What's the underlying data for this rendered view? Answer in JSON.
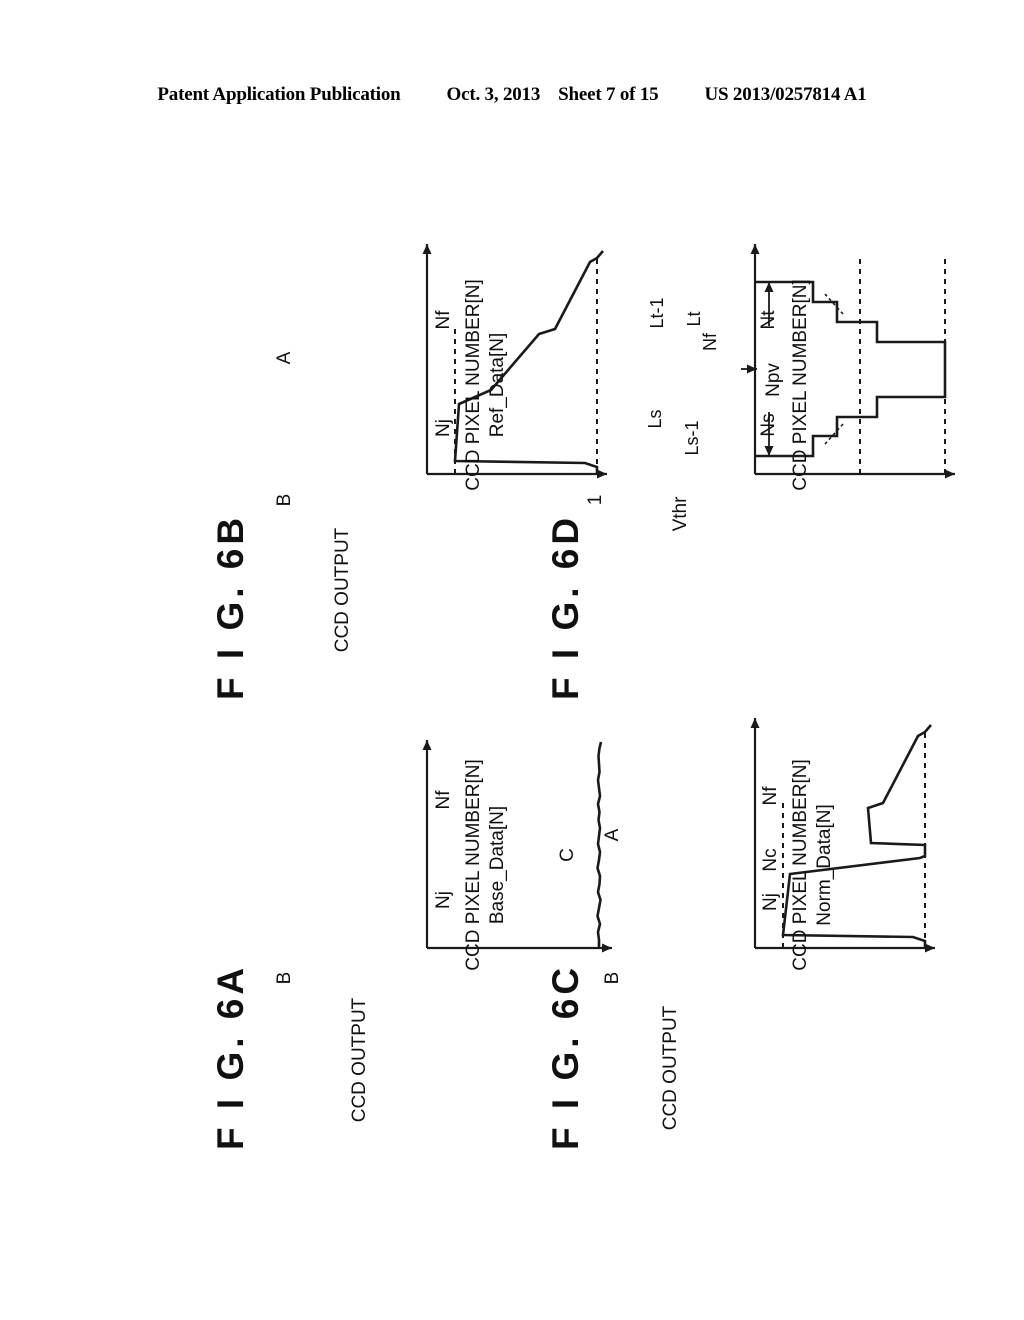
{
  "header": {
    "publication": "Patent Application Publication",
    "date": "Oct. 3, 2013",
    "sheet": "Sheet 7 of 15",
    "patent_number": "US 2013/0257814 A1"
  },
  "figures": [
    {
      "id": "fig-6a",
      "title": "F I G.  6A",
      "y_axis_label": "CCD OUTPUT",
      "x_axis_label_line1": "CCD PIXEL NUMBER[N]",
      "x_axis_label_line2": "Base_Data[N]",
      "y_ticks": [
        "B"
      ],
      "x_ticks": [
        "Nj",
        "Nf"
      ]
    },
    {
      "id": "fig-6b",
      "title": "F I G.  6B",
      "y_axis_label": "CCD OUTPUT",
      "x_axis_label_line1": "CCD PIXEL NUMBER[N]",
      "x_axis_label_line2": "Ref_Data[N]",
      "y_ticks": [
        "B",
        "A"
      ],
      "x_ticks": [
        "Nj",
        "Nf"
      ]
    },
    {
      "id": "fig-6c",
      "title": "F I G.  6C",
      "y_axis_label": "CCD OUTPUT",
      "x_axis_label_line1": "CCD PIXEL NUMBER[N]",
      "x_axis_label_line2": "Norm_Data[N]",
      "y_ticks": [
        "B",
        "A"
      ],
      "x_ticks": [
        "Nj",
        "Nc",
        "Nf"
      ],
      "annotations": [
        "C"
      ]
    },
    {
      "id": "fig-6d",
      "title": "F I G.  6D",
      "y_axis_label": "",
      "x_axis_label_line1": "CCD PIXEL NUMBER[N]",
      "x_axis_label_line2": "",
      "y_ticks": [
        "1",
        "Vthr"
      ],
      "x_ticks": [
        "Ns",
        "Npv",
        "Nt"
      ],
      "annotations": [
        "Ls",
        "Ls-1",
        "Lt-1",
        "Lt",
        "Nf"
      ]
    }
  ],
  "chart_data": [
    {
      "type": "line",
      "figure": "6A",
      "title": "F I G.  6A",
      "xlabel": "CCD PIXEL NUMBER[N] Base_Data[N]",
      "ylabel": "CCD OUTPUT",
      "xticks": [
        "Nj",
        "Nf"
      ],
      "yticks": [
        "B"
      ],
      "series": [
        {
          "name": "Base_Data[N]",
          "description": "Nearly flat noisy signal held at level B across all pixel numbers",
          "points": [
            {
              "x": 0,
              "y": 1.0
            },
            {
              "x": 0.08,
              "y": 1.0
            },
            {
              "x": 0.16,
              "y": 0.995
            },
            {
              "x": 0.24,
              "y": 1.005
            },
            {
              "x": 0.33,
              "y": 0.99
            },
            {
              "x": 0.42,
              "y": 1.0
            },
            {
              "x": 0.5,
              "y": 1.008
            },
            {
              "x": 0.58,
              "y": 0.995
            },
            {
              "x": 0.66,
              "y": 1.0
            },
            {
              "x": 0.75,
              "y": 1.005
            },
            {
              "x": 0.83,
              "y": 0.992
            },
            {
              "x": 0.92,
              "y": 1.0
            },
            {
              "x": 1.0,
              "y": 1.0
            }
          ]
        }
      ]
    },
    {
      "type": "line",
      "figure": "6B",
      "title": "F I G.  6B",
      "xlabel": "CCD PIXEL NUMBER[N] Ref_Data[N]",
      "ylabel": "CCD OUTPUT",
      "xticks": [
        "Nj",
        "Nf"
      ],
      "yticks": [
        "B",
        "A"
      ],
      "series": [
        {
          "name": "Ref_Data[N]",
          "description": "Starts at B, drops to A near Nj, slowly rises, steps up and returns to B after Nf",
          "points": [
            {
              "x": 0.0,
              "y": 1.0
            },
            {
              "x": 0.03,
              "y": 1.0
            },
            {
              "x": 0.05,
              "y": 0.93
            },
            {
              "x": 0.06,
              "y": 0.0
            },
            {
              "x": 0.3,
              "y": 0.06
            },
            {
              "x": 0.36,
              "y": 0.3
            },
            {
              "x": 0.6,
              "y": 0.62
            },
            {
              "x": 0.62,
              "y": 0.7
            },
            {
              "x": 0.96,
              "y": 0.95
            },
            {
              "x": 0.97,
              "y": 1.0
            },
            {
              "x": 1.0,
              "y": 1.0
            }
          ]
        }
      ]
    },
    {
      "type": "line",
      "figure": "6C",
      "title": "F I G.  6C",
      "xlabel": "CCD PIXEL NUMBER[N] Norm_Data[N]",
      "ylabel": "CCD OUTPUT",
      "xticks": [
        "Nj",
        "Nc",
        "Nf"
      ],
      "yticks": [
        "B",
        "A"
      ],
      "annotation": "C",
      "series": [
        {
          "name": "Norm_Data[N]",
          "description": "Like Ref_Data but with a narrow full-height spike to B at pixel Nc",
          "points": [
            {
              "x": 0.0,
              "y": 1.0
            },
            {
              "x": 0.03,
              "y": 1.0
            },
            {
              "x": 0.05,
              "y": 0.93
            },
            {
              "x": 0.06,
              "y": 0.0
            },
            {
              "x": 0.32,
              "y": 0.08
            },
            {
              "x": 0.4,
              "y": 0.78
            },
            {
              "x": 0.42,
              "y": 1.0
            },
            {
              "x": 0.46,
              "y": 1.0
            },
            {
              "x": 0.47,
              "y": 0.66
            },
            {
              "x": 0.6,
              "y": 0.63
            },
            {
              "x": 0.62,
              "y": 0.72
            },
            {
              "x": 0.96,
              "y": 0.95
            },
            {
              "x": 0.97,
              "y": 1.0
            },
            {
              "x": 1.0,
              "y": 1.0
            }
          ]
        }
      ]
    },
    {
      "type": "line",
      "figure": "6D",
      "title": "F I G.  6D",
      "xlabel": "CCD PIXEL NUMBER[N]",
      "ylabel": "",
      "xticks": [
        "Ns",
        "Npv",
        "Nt"
      ],
      "yticks": [
        "1",
        "Vthr"
      ],
      "annotations": [
        "Ls",
        "Ls-1",
        "Lt-1",
        "Lt",
        "Nf"
      ],
      "series": [
        {
          "name": "staircase",
          "description": "Symmetric staircase rising from below Vthr at Ns through Ls-1, Ls to level 1 at the peak Npv, then descending through Lt, Lt-1 to Nt",
          "steps": [
            {
              "x": 0.0,
              "level": 0.12
            },
            {
              "x": 0.07,
              "level": 0.34
            },
            {
              "x": 0.16,
              "level": 0.46
            },
            {
              "x": 0.26,
              "level": 0.72
            },
            {
              "x": 0.4,
              "level": 1.0
            },
            {
              "x": 0.6,
              "level": 0.72
            },
            {
              "x": 0.74,
              "level": 0.46
            },
            {
              "x": 0.84,
              "level": 0.34
            },
            {
              "x": 0.93,
              "level": 0.12
            }
          ],
          "threshold": {
            "label": "Vthr",
            "level": 0.4
          },
          "max": {
            "label": "1",
            "level": 1.0
          }
        }
      ]
    }
  ]
}
